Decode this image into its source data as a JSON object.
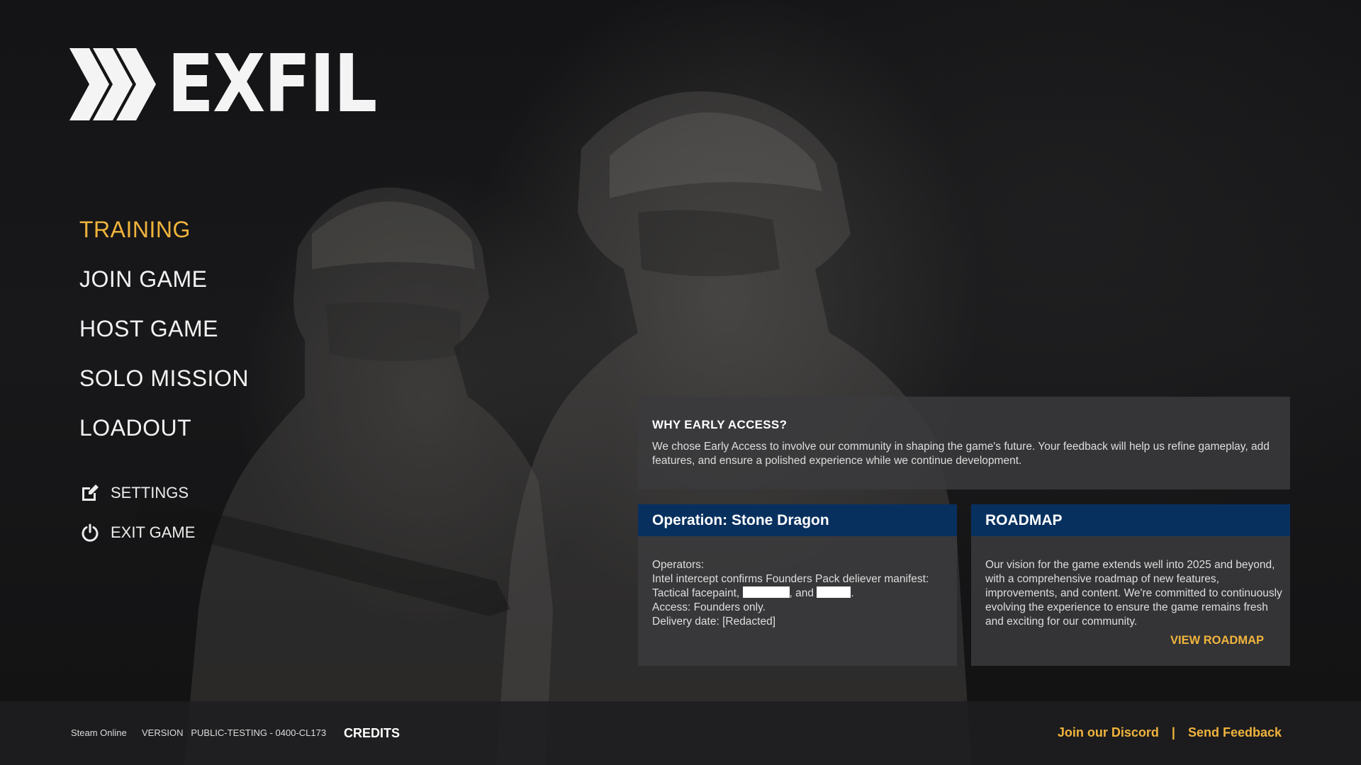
{
  "logo": {
    "text": "EXFIL"
  },
  "main_menu": {
    "items": [
      {
        "label": "TRAINING",
        "active": true
      },
      {
        "label": "JOIN GAME"
      },
      {
        "label": "HOST GAME"
      },
      {
        "label": "SOLO MISSION"
      },
      {
        "label": "LOADOUT"
      }
    ]
  },
  "sub_menu": {
    "settings": {
      "label": "SETTINGS",
      "icon": "edit-icon"
    },
    "exit": {
      "label": "EXIT GAME",
      "icon": "power-icon"
    }
  },
  "early_access": {
    "title": "WHY EARLY ACCESS?",
    "body": "We chose Early Access to involve our community in shaping the game's future. Your feedback will help us refine gameplay, add features, and ensure a polished experience while we continue development."
  },
  "operation": {
    "title": "Operation: Stone Dragon",
    "line1": "Operators:",
    "line2": "Intel intercept confirms Founders Pack deliever manifest:",
    "line3_prefix": "Tactical facepaint,",
    "line3_and": ", and",
    "line3_suffix": ".",
    "line4": "Access: Founders only.",
    "line5": "Delivery date: [Redacted]"
  },
  "roadmap": {
    "title": "ROADMAP",
    "body": "Our vision for the game extends well into 2025 and beyond, with a comprehensive roadmap of new features, improvements, and content. We're committed to continuously evolving the experience to ensure the game remains fresh and exciting for our community.",
    "link": "VIEW ROADMAP"
  },
  "footer": {
    "status": "Steam Online",
    "version": "VERSION   PUBLIC-TESTING - 0400-CL173",
    "credits": "CREDITS",
    "discord": "Join our Discord",
    "separator": "|",
    "feedback": "Send Feedback"
  },
  "colors": {
    "accent": "#f0b43c",
    "panel_header": "#08305f",
    "panel_bg": "#3a3a3c"
  }
}
